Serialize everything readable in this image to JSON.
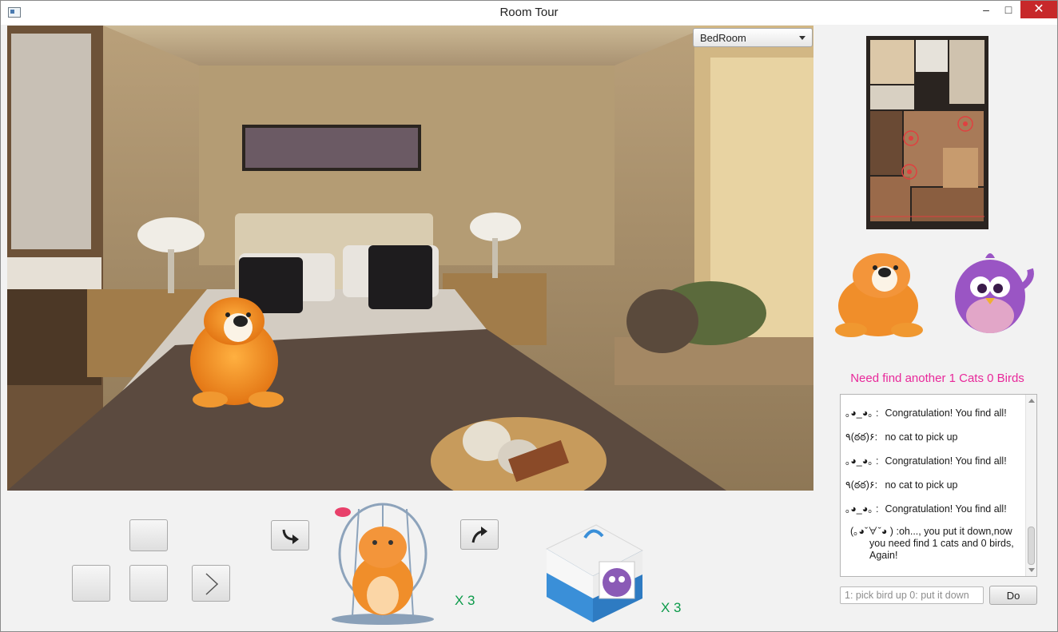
{
  "window": {
    "title": "Room Tour",
    "minimize_glyph": "–",
    "maximize_glyph": "□",
    "close_glyph": "✕"
  },
  "room_select": {
    "selected": "BedRoom"
  },
  "inventory": {
    "cats_count": "X 3",
    "birds_count": "X 3"
  },
  "status": "Need find another 1 Cats 0 Birds",
  "log": [
    {
      "face": "｡◕_◕｡ :",
      "text": "Congratulation! You find all!"
    },
    {
      "face": "٩(ఠఠ)۶:",
      "text": "no cat to pick up"
    },
    {
      "face": "｡◕_◕｡ :",
      "text": "Congratulation! You find all!"
    },
    {
      "face": "٩(ఠఠ)۶:",
      "text": "no cat to pick up"
    },
    {
      "face": "｡◕_◕｡ :",
      "text": "Congratulation! You find all!"
    },
    {
      "face": "(｡◕ˇ∀ˇ◕ )",
      "text": ":oh..., you put it down,now you need find 1 cats and 0 birds, Again!"
    }
  ],
  "command": {
    "placeholder": "1: pick bird up 0: put it down",
    "button_label": "Do"
  },
  "colors": {
    "status": "#e8289a",
    "count": "#0c9a4a"
  },
  "icons": {
    "nav_right": "chevron-right-icon",
    "rotate_left": "turn-down-right-arrow-icon",
    "rotate_right": "turn-up-right-arrow-icon"
  }
}
